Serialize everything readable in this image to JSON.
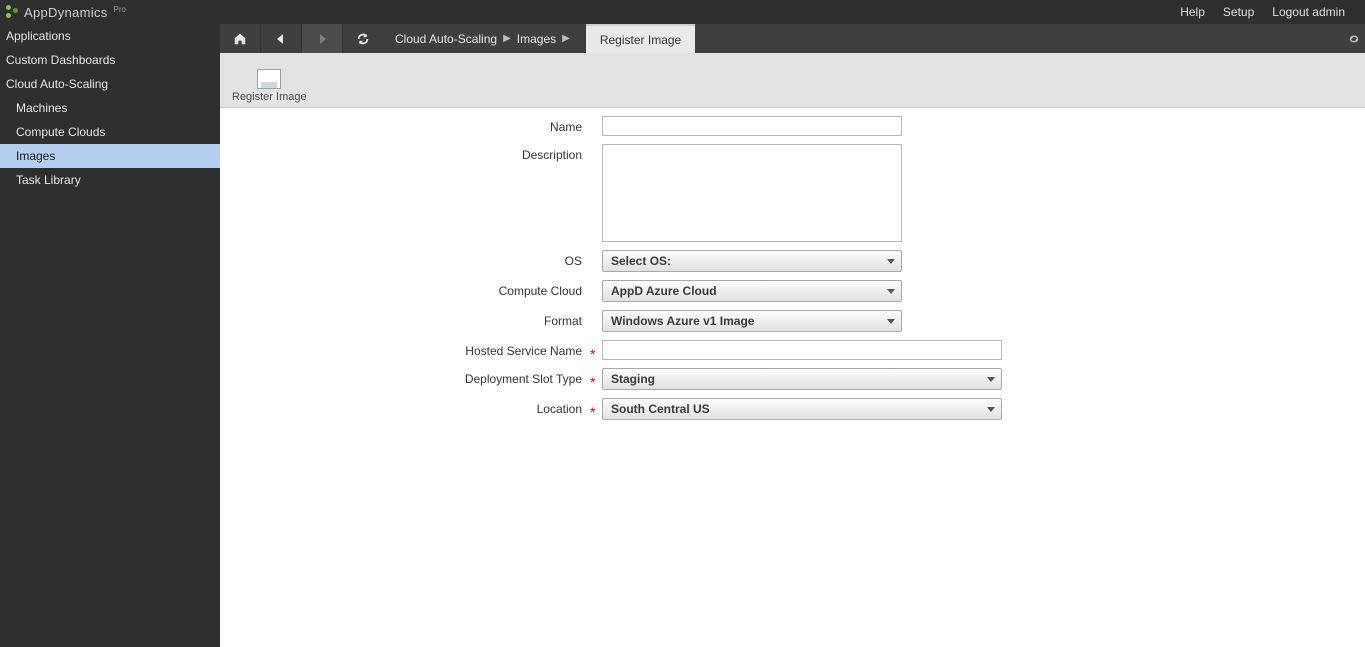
{
  "header": {
    "brand": "AppDynamics",
    "brand_suffix": "Pro",
    "right_links": {
      "help": "Help",
      "setup": "Setup",
      "logout": "Logout admin"
    }
  },
  "sidebar": {
    "items": [
      {
        "label": "Applications",
        "indent": 0,
        "selected": false
      },
      {
        "label": "Custom Dashboards",
        "indent": 0,
        "selected": false
      },
      {
        "label": "Cloud Auto-Scaling",
        "indent": 0,
        "selected": false
      },
      {
        "label": "Machines",
        "indent": 1,
        "selected": false
      },
      {
        "label": "Compute Clouds",
        "indent": 1,
        "selected": false
      },
      {
        "label": "Images",
        "indent": 1,
        "selected": true
      },
      {
        "label": "Task Library",
        "indent": 1,
        "selected": false
      }
    ]
  },
  "breadcrumb": {
    "items": [
      "Cloud Auto-Scaling",
      "Images"
    ],
    "current_tab": "Register Image"
  },
  "subtoolbar": {
    "register_label": "Register Image"
  },
  "form": {
    "labels": {
      "name": "Name",
      "description": "Description",
      "os": "OS",
      "compute_cloud": "Compute Cloud",
      "format": "Format",
      "hosted_service": "Hosted Service Name",
      "deployment_slot": "Deployment Slot Type",
      "location": "Location"
    },
    "values": {
      "name": "",
      "description": "",
      "os": "Select OS:",
      "compute_cloud": "AppD Azure Cloud",
      "format": "Windows Azure v1 Image",
      "hosted_service": "",
      "deployment_slot": "Staging",
      "location": "South Central US"
    }
  }
}
